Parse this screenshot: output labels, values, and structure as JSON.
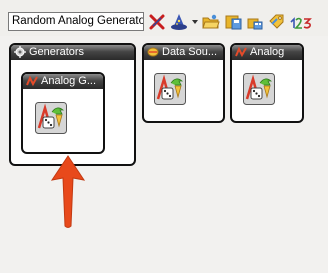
{
  "toolbar": {
    "block_selector_value": "Random Analog Generator",
    "icons": [
      "delete-icon",
      "wizard-icon",
      "open-folder-icon",
      "save-icon",
      "network-icon",
      "tag-icon",
      "numbers-icon"
    ],
    "numbers_label": "123"
  },
  "windows": {
    "generators": {
      "title": "Generators"
    },
    "analog_generator": {
      "title": "Analog G..."
    },
    "data_sources": {
      "title": "Data Sou..."
    },
    "analog": {
      "title": "Analog"
    }
  },
  "colors": {
    "titlebar_dark": "#2a2a2a",
    "arrow": "#e8491b",
    "background": "#f2f1ef"
  }
}
